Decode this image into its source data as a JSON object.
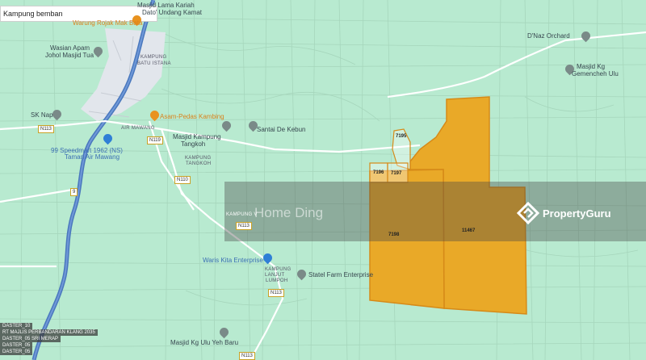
{
  "search": {
    "value": "Kampung bemban"
  },
  "places": {
    "warung_rojak": "Warung Rojak Mak Bata",
    "masjid_lama_1": "Masjid Lama Kariah",
    "masjid_lama_2": "Dato' Undang Kamat",
    "wasian_1": "Wasian Apam",
    "wasian_2": "Johol Masjid Tua",
    "kampung_batu_1": "KAMPUNG",
    "kampung_batu_2": "BATU ISTANA",
    "sk_nap": "SK Nap",
    "asam_pedas": "Asam-Pedas Kambing",
    "air_mawang": "AIR MAWANG",
    "masjid_kampung_1": "Masjid Kampung",
    "masjid_kampung_2": "Tangkoh",
    "santai": "Santai De Kebun",
    "speedmart_1": "99 Speedmart 1962 (NS)",
    "speedmart_2": "Taman Air Mawang",
    "kampung_tangkoh_1": "KAMPUNG",
    "kampung_tangkoh_2": "TANGKOH",
    "kampung_v": "KAMPUNG V",
    "waris_kita": "Waris Kita Enterprise",
    "kampung_lanjut_1": "KAMPUNG",
    "kampung_lanjut_2": "LANJUT",
    "kampung_lanjut_3": "LUMPOH",
    "statel_farm": "Statel Farm Enterprise",
    "masjid_kg_ulu": "Masjid Kg Ulu Yeh Baru",
    "dnaz": "D'Naz Orchard",
    "masjid_kg_1": "Masjid Kg",
    "masjid_kg_2": "Gemencheh Ulu"
  },
  "roads": {
    "n119": "N119",
    "n113a": "N113",
    "n113b": "N113",
    "n110": "N110",
    "n9": "9",
    "n113c": "N113",
    "n113d": "N113"
  },
  "lots": {
    "l7195": "7195",
    "l7196": "7196",
    "l7197": "7197",
    "l7198": "7198",
    "l11467": "11467"
  },
  "watermark": "Home Ding",
  "brand": "PropertyGuru",
  "left_tags": [
    "DASTER_10",
    "RT MAJLIS PERBANDARAN KLANG 2035",
    "DASTER_05",
    "DASTER_05",
    "DASTER_05"
  ],
  "left_tag_extra": "SRI MERAP",
  "colors": {
    "land": "#b8ead0",
    "river": "#4a78bd",
    "lot_fill": "#e9a928",
    "lot_stroke": "#d68a18"
  }
}
